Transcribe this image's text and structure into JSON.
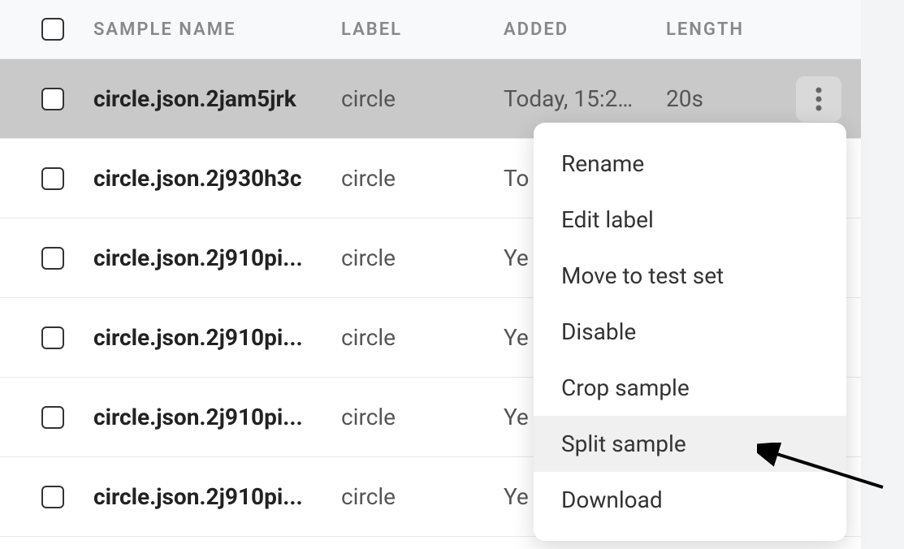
{
  "table": {
    "headers": {
      "name": "SAMPLE NAME",
      "label": "LABEL",
      "added": "ADDED",
      "length": "LENGTH"
    },
    "rows": [
      {
        "name": "circle.json.2jam5jrk",
        "label": "circle",
        "added": "Today, 15:2…",
        "length": "20s",
        "selected": true
      },
      {
        "name": "circle.json.2j930h3c",
        "label": "circle",
        "added": "To",
        "length": "",
        "selected": false
      },
      {
        "name": "circle.json.2j910pi...",
        "label": "circle",
        "added": "Ye",
        "length": "",
        "selected": false
      },
      {
        "name": "circle.json.2j910pi...",
        "label": "circle",
        "added": "Ye",
        "length": "",
        "selected": false
      },
      {
        "name": "circle.json.2j910pi...",
        "label": "circle",
        "added": "Ye",
        "length": "",
        "selected": false
      },
      {
        "name": "circle.json.2j910pi...",
        "label": "circle",
        "added": "Ye",
        "length": "",
        "selected": false
      }
    ]
  },
  "menu": {
    "items": [
      {
        "label": "Rename",
        "hovered": false
      },
      {
        "label": "Edit label",
        "hovered": false
      },
      {
        "label": "Move to test set",
        "hovered": false
      },
      {
        "label": "Disable",
        "hovered": false
      },
      {
        "label": "Crop sample",
        "hovered": false
      },
      {
        "label": "Split sample",
        "hovered": true
      },
      {
        "label": "Download",
        "hovered": false
      }
    ]
  }
}
